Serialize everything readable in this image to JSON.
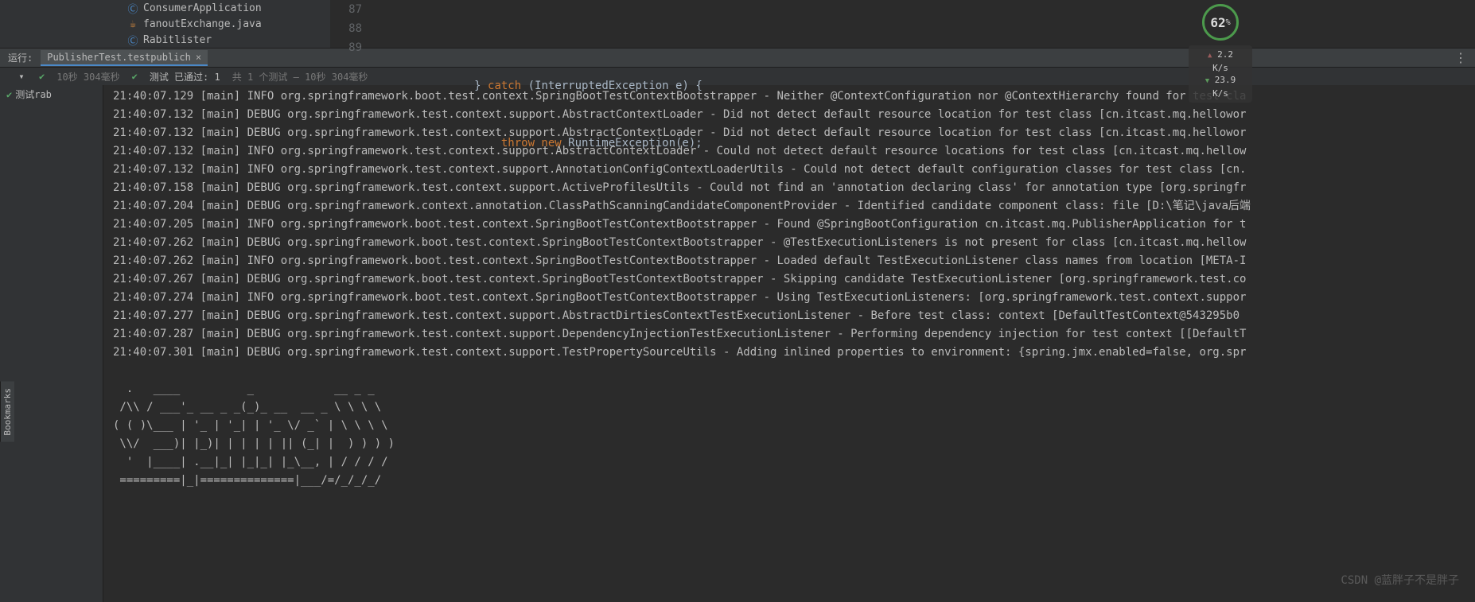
{
  "project_tree": {
    "items": [
      {
        "label": "ConsumerApplication",
        "icon": "class-icon"
      },
      {
        "label": "fanoutExchange.java",
        "icon": "java-icon"
      },
      {
        "label": "Rabitlister",
        "icon": "class-icon"
      }
    ]
  },
  "editor": {
    "lines": [
      {
        "num": "87",
        "code_html": ""
      },
      {
        "num": "88",
        "code_html": "            } <span class='kw'>catch</span> (InterruptedException e) {"
      },
      {
        "num": "89",
        "code_html": "                <span class='kw'>throw new</span> RuntimeException(e);"
      }
    ]
  },
  "run_bar": {
    "run_label": "运行:",
    "tab_name": "PublisherTest.testpublich"
  },
  "test_header": {
    "timing1": "10秒 304毫秒",
    "pass_label": "测试 已通过: 1",
    "pass_detail": "共 1 个测试 – 10秒 304毫秒"
  },
  "test_tree": {
    "node": "测试rab"
  },
  "console_lines": [
    "21:40:07.129 [main] INFO org.springframework.boot.test.context.SpringBootTestContextBootstrapper - Neither @ContextConfiguration nor @ContextHierarchy found for test cla",
    "21:40:07.132 [main] DEBUG org.springframework.test.context.support.AbstractContextLoader - Did not detect default resource location for test class [cn.itcast.mq.hellowor",
    "21:40:07.132 [main] DEBUG org.springframework.test.context.support.AbstractContextLoader - Did not detect default resource location for test class [cn.itcast.mq.hellowor",
    "21:40:07.132 [main] INFO org.springframework.test.context.support.AbstractContextLoader - Could not detect default resource locations for test class [cn.itcast.mq.hellow",
    "21:40:07.132 [main] INFO org.springframework.test.context.support.AnnotationConfigContextLoaderUtils - Could not detect default configuration classes for test class [cn.",
    "21:40:07.158 [main] DEBUG org.springframework.test.context.support.ActiveProfilesUtils - Could not find an 'annotation declaring class' for annotation type [org.springfr",
    "21:40:07.204 [main] DEBUG org.springframework.context.annotation.ClassPathScanningCandidateComponentProvider - Identified candidate component class: file [D:\\笔记\\java后端",
    "21:40:07.205 [main] INFO org.springframework.boot.test.context.SpringBootTestContextBootstrapper - Found @SpringBootConfiguration cn.itcast.mq.PublisherApplication for t",
    "21:40:07.262 [main] DEBUG org.springframework.boot.test.context.SpringBootTestContextBootstrapper - @TestExecutionListeners is not present for class [cn.itcast.mq.hellow",
    "21:40:07.262 [main] INFO org.springframework.boot.test.context.SpringBootTestContextBootstrapper - Loaded default TestExecutionListener class names from location [META-I",
    "21:40:07.267 [main] DEBUG org.springframework.boot.test.context.SpringBootTestContextBootstrapper - Skipping candidate TestExecutionListener [org.springframework.test.co",
    "21:40:07.274 [main] INFO org.springframework.boot.test.context.SpringBootTestContextBootstrapper - Using TestExecutionListeners: [org.springframework.test.context.suppor",
    "21:40:07.277 [main] DEBUG org.springframework.test.context.support.AbstractDirtiesContextTestExecutionListener - Before test class: context [DefaultTestContext@543295b0",
    "21:40:07.287 [main] DEBUG org.springframework.test.context.support.DependencyInjectionTestExecutionListener - Performing dependency injection for test context [[DefaultT",
    "21:40:07.301 [main] DEBUG org.springframework.test.context.support.TestPropertySourceUtils - Adding inlined properties to environment: {spring.jmx.enabled=false, org.spr"
  ],
  "ascii_art": [
    "  .   ____          _            __ _ _",
    " /\\\\ / ___'_ __ _ _(_)_ __  __ _ \\ \\ \\ \\",
    "( ( )\\___ | '_ | '_| | '_ \\/ _` | \\ \\ \\ \\",
    " \\\\/  ___)| |_)| | | | | || (_| |  ) ) ) )",
    "  '  |____| .__|_| |_|_| |_\\__, | / / / /",
    " =========|_|==============|___/=/_/_/_/"
  ],
  "perf": {
    "cpu": "62",
    "pct": "%",
    "up": "2.2",
    "up_unit": "K/s",
    "down": "23.9",
    "down_unit": "K/s"
  },
  "bookmarks_label": "Bookmarks",
  "watermark": "CSDN @蓝胖子不是胖子"
}
